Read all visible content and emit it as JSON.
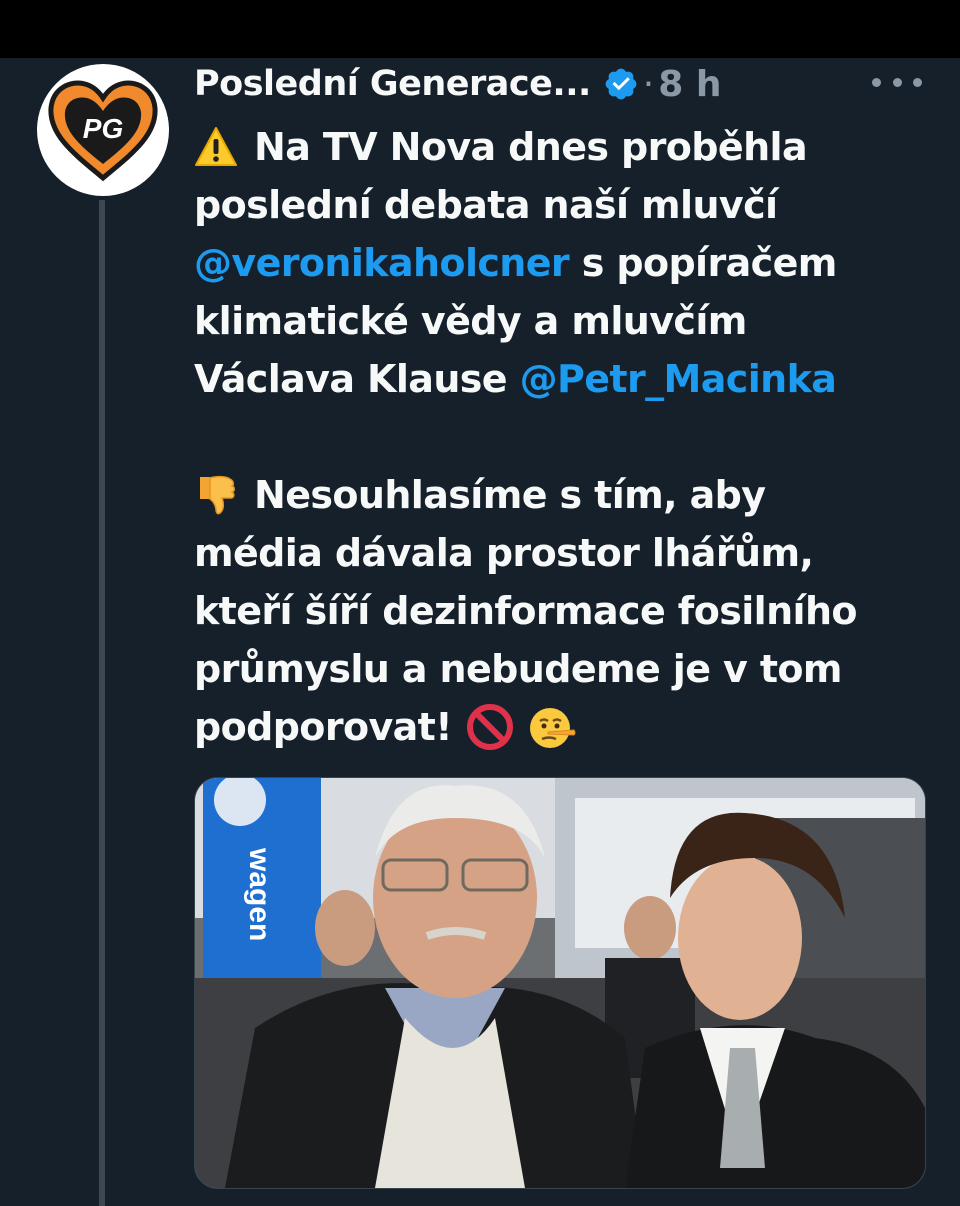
{
  "tweet": {
    "author_name": "Poslední Generace...",
    "avatar_text": "PG",
    "time": "8 h",
    "separator": "·",
    "lines": {
      "l1": "Na TV Nova dnes proběhla",
      "l2": "poslední debata naší mluvčí",
      "l3_mention": "@veronikaholcner",
      "l3_rest": " s popíračem",
      "l4": "klimatické vědy a mluvčím",
      "l5_pre": "Václava Klause ",
      "l5_mention": "@Petr_Macinka",
      "l6": "Nesouhlasíme s tím, aby",
      "l7": "média dávala prostor lhářům,",
      "l8": "kteří šíří dezinformace fosilního",
      "l9": "průmyslu a nebudeme je v tom",
      "l10": "podporovat!"
    },
    "icons": {
      "warning": "warning-icon",
      "thumbs_down": "thumbs-down-icon",
      "prohibited": "prohibited-icon",
      "lying_face": "lying-face-icon",
      "verified": "verified-badge-icon",
      "more": "more-options-icon"
    },
    "image": {
      "banner_text": "wagen"
    }
  },
  "colors": {
    "background": "#15202b",
    "text": "#f7f9f9",
    "muted": "#8b98a5",
    "accent": "#1d9bf0"
  }
}
